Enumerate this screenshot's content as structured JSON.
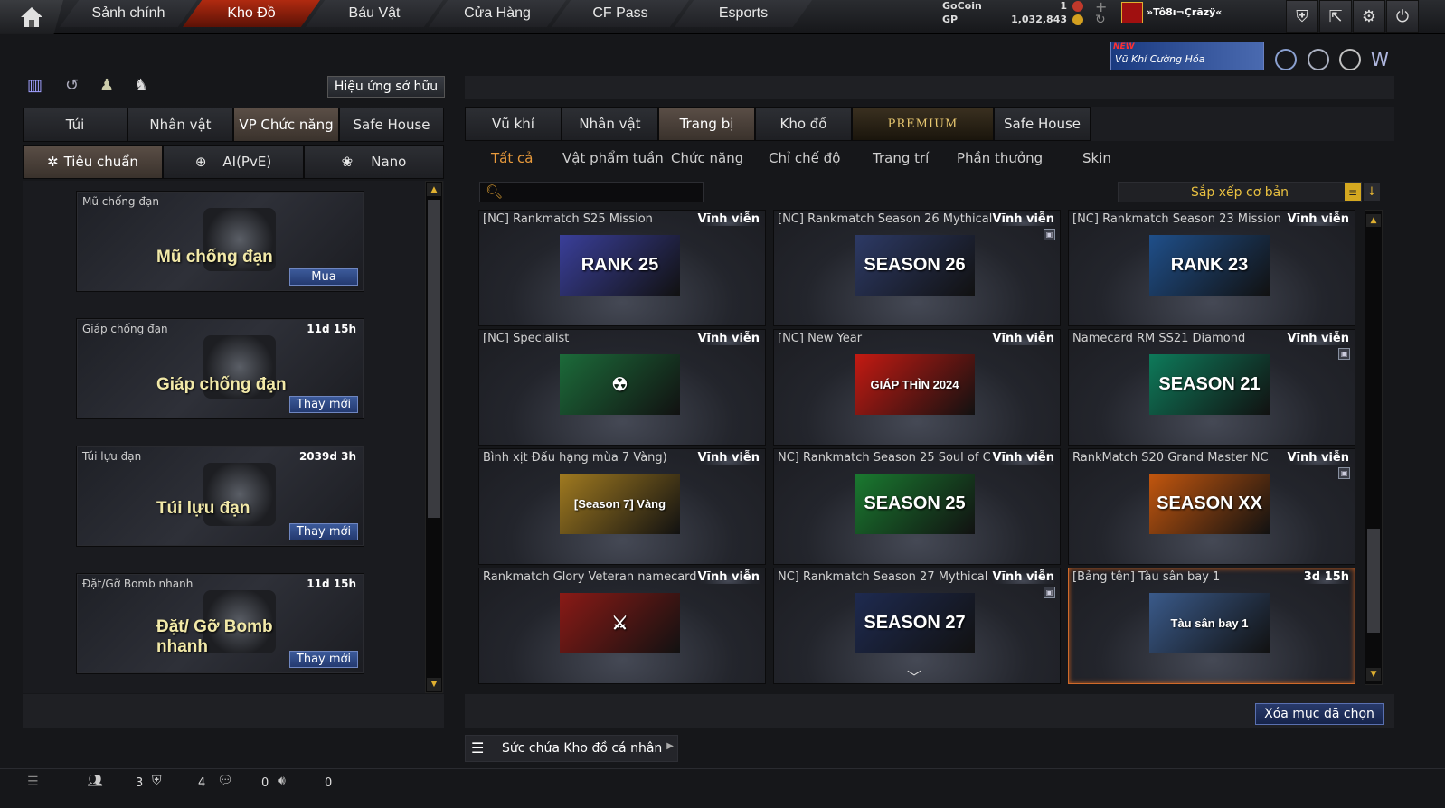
{
  "nav": {
    "tabs": [
      "Sảnh chính",
      "Kho Đồ",
      "Báu Vật",
      "Cửa Hàng",
      "CF Pass",
      "Esports"
    ],
    "active": 1
  },
  "currency": {
    "gocoin_label": "GoCoin",
    "gocoin_value": "1",
    "gp_label": "GP",
    "gp_value": "1,032,843"
  },
  "player": {
    "name": "»Tô8ı¬Çrãzÿ«"
  },
  "promo": {
    "new": "NEW",
    "text": "Vũ Khí Cường Hóa"
  },
  "left": {
    "effect_btn": "Hiệu ứng sở hữu",
    "tabs": [
      "Túi",
      "Nhân vật",
      "VP Chức năng",
      "Safe House"
    ],
    "subtabs": [
      "Tiêu chuẩn",
      "AI(PvE)",
      "Nano"
    ],
    "cards": [
      {
        "title": "Mũ chống đạn",
        "time": "",
        "big": "Mũ chống đạn",
        "btn": "Mua"
      },
      {
        "title": "Giáp chống đạn",
        "time": "11d 15h",
        "big": "Giáp chống đạn",
        "btn": "Thay mới"
      },
      {
        "title": "Túi lựu đạn",
        "time": "2039d 3h",
        "big": "Túi lựu đạn",
        "btn": "Thay mới"
      },
      {
        "title": "Đặt/Gỡ Bomb nhanh",
        "time": "11d 15h",
        "big": "Đặt/ Gỡ Bomb nhanh",
        "btn": "Thay mới"
      }
    ]
  },
  "right": {
    "tabs": [
      "Vũ khí",
      "Nhân vật",
      "Trang bị",
      "Kho đồ",
      "PREMIUM",
      "Safe House"
    ],
    "subtabs": [
      "Tất cả",
      "Vật phẩm tuần",
      "Chức năng",
      "Chỉ chế độ",
      "Trang trí",
      "Phần thưởng",
      "Skin"
    ],
    "sort": "Sắp xếp cơ bản",
    "search_placeholder": "",
    "items": [
      {
        "name": "[NC] Rankmatch S25 Mission",
        "dur": "Vĩnh viễn",
        "banner": "RANK 25",
        "color": "#3a3f9a",
        "lock": false
      },
      {
        "name": "[NC] Rankmatch Season 26 Mythical",
        "dur": "Vĩnh viễn",
        "banner": "SEASON 26",
        "color": "#2d3a66",
        "lock": true
      },
      {
        "name": "[NC] Rankmatch Season 23 Mission",
        "dur": "Vĩnh viễn",
        "banner": "RANK 23",
        "color": "#1f4f8a",
        "lock": false
      },
      {
        "name": "[NC] Specialist",
        "dur": "Vĩnh viễn",
        "banner": "☢",
        "color": "#1c6b3a",
        "lock": false
      },
      {
        "name": "[NC] New Year",
        "dur": "Vĩnh viễn",
        "banner": "GIÁP THÌN 2024",
        "color": "#c41a12",
        "lock": false
      },
      {
        "name": "Namecard RM SS21 Diamond",
        "dur": "Vĩnh viễn",
        "banner": "SEASON 21",
        "color": "#0e7a5a",
        "lock": true
      },
      {
        "name": "Bình xịt Đấu hạng mùa 7 Vàng)",
        "dur": "Vĩnh viễn",
        "banner": "[Season 7] Vàng",
        "color": "#a07a20",
        "lock": false
      },
      {
        "name": "NC] Rankmatch Season 25 Soul of C",
        "dur": "Vĩnh viễn",
        "banner": "SEASON 25",
        "color": "#1a7a30",
        "lock": false
      },
      {
        "name": "RankMatch S20 Grand Master NC",
        "dur": "Vĩnh viễn",
        "banner": "SEASON XX",
        "color": "#c2560e",
        "lock": true
      },
      {
        "name": "Rankmatch Glory Veteran namecard",
        "dur": "Vĩnh viễn",
        "banner": "⚔",
        "color": "#8a1a16",
        "lock": false
      },
      {
        "name": "NC] Rankmatch Season 27 Mythical",
        "dur": "Vĩnh viễn",
        "banner": "SEASON 27",
        "color": "#1e2a50",
        "lock": true
      },
      {
        "name": "[Bảng tên] Tàu sân bay 1",
        "dur": "3d 15h",
        "banner": "Tàu sân bay 1",
        "color": "#3a5a8a",
        "lock": false
      }
    ],
    "delete_btn": "Xóa mục đã chọn",
    "capacity": "Sức chứa Kho đồ cá nhân"
  },
  "footer": {
    "counts": [
      "3",
      "4",
      "0",
      "0"
    ]
  }
}
